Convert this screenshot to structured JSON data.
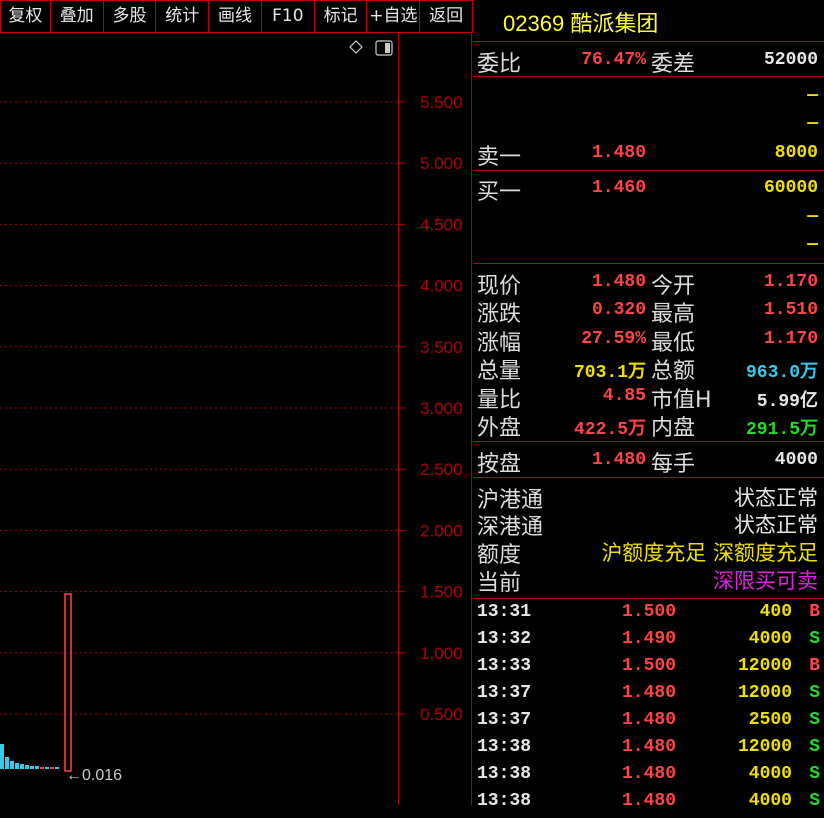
{
  "toolbar": [
    "复权",
    "叠加",
    "多股",
    "统计",
    "画线",
    "F10",
    "标记",
    "+自选",
    "返回"
  ],
  "chart": {
    "y_ticks": [
      "5.500",
      "5.000",
      "4.500",
      "4.000",
      "3.500",
      "3.000",
      "2.500",
      "2.000",
      "1.500",
      "1.000",
      "0.500"
    ],
    "min_label": "←0.016",
    "icons": {
      "diamond": "diamond-icon",
      "toggle": "panel-toggle-icon"
    }
  },
  "header": {
    "code": "02369",
    "name": "酷派集团"
  },
  "weibi": {
    "label": "委比",
    "value": "76.47%",
    "label2": "委差",
    "value2": "52000"
  },
  "ask": [
    {
      "label": "",
      "price": "",
      "vol": "—"
    },
    {
      "label": "",
      "price": "",
      "vol": "—"
    },
    {
      "label": "卖一",
      "price": "1.480",
      "vol": "8000"
    }
  ],
  "bid": [
    {
      "label": "买一",
      "price": "1.460",
      "vol": "60000"
    },
    {
      "label": "",
      "price": "",
      "vol": "—"
    },
    {
      "label": "",
      "price": "",
      "vol": "—"
    }
  ],
  "quote": [
    {
      "l1": "现价",
      "v1": "1.480",
      "u1": "",
      "l2": "今开",
      "v2": "1.170",
      "u2": ""
    },
    {
      "l1": "涨跌",
      "v1": "0.320",
      "u1": "",
      "l2": "最高",
      "v2": "1.510",
      "u2": ""
    },
    {
      "l1": "涨幅",
      "v1": "27.59%",
      "u1": "",
      "l2": "最低",
      "v2": "1.170",
      "u2": ""
    },
    {
      "l1": "总量",
      "v1": "703.1",
      "u1": "万",
      "l2": "总额",
      "v2": "963.0",
      "u2": "万"
    },
    {
      "l1": "量比",
      "v1": "4.85",
      "u1": "",
      "l2": "市值H",
      "v2": "5.99",
      "u2": "亿"
    },
    {
      "l1": "外盘",
      "v1": "422.5",
      "u1": "万",
      "l2": "内盘",
      "v2": "291.5",
      "u2": "万"
    }
  ],
  "anpan": {
    "label": "按盘",
    "value": "1.480",
    "label2": "每手",
    "value2": "4000"
  },
  "connect": [
    {
      "label": "沪港通",
      "value": "状态正常"
    },
    {
      "label": "深港通",
      "value": "状态正常"
    },
    {
      "label": "额度",
      "value": "沪额度充足 深额度充足"
    },
    {
      "label": "当前",
      "value": "深限买可卖"
    }
  ],
  "trades": [
    {
      "time": "13:31",
      "price": "1.500",
      "qty": "400",
      "dir": "B"
    },
    {
      "time": "13:32",
      "price": "1.490",
      "qty": "4000",
      "dir": "S"
    },
    {
      "time": "13:33",
      "price": "1.500",
      "qty": "12000",
      "dir": "B"
    },
    {
      "time": "13:37",
      "price": "1.480",
      "qty": "12000",
      "dir": "S"
    },
    {
      "time": "13:37",
      "price": "1.480",
      "qty": "2500",
      "dir": "S"
    },
    {
      "time": "13:38",
      "price": "1.480",
      "qty": "12000",
      "dir": "S"
    },
    {
      "time": "13:38",
      "price": "1.480",
      "qty": "4000",
      "dir": "S"
    },
    {
      "time": "13:38",
      "price": "1.480",
      "qty": "4000",
      "dir": "S"
    }
  ],
  "colors": {
    "up": "#ff4444",
    "down": "#22dd22",
    "grid": "#b00000",
    "volume": "#33ccee",
    "vol_amount": "#33ccee"
  }
}
